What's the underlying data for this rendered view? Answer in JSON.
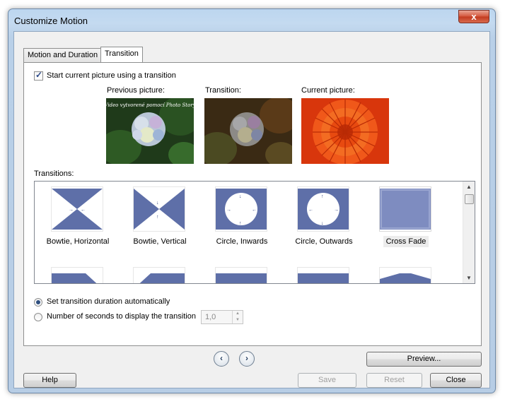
{
  "window": {
    "title": "Customize Motion",
    "close_glyph": "x"
  },
  "tabs": [
    {
      "label": "Motion and Duration",
      "active": false
    },
    {
      "label": "Transition",
      "active": true
    }
  ],
  "start_with_transition": {
    "label": "Start current picture using a transition",
    "checked": true
  },
  "pictures": [
    {
      "caption": "Previous picture:",
      "overlay_text": "Video vytvorené pomocí Photo Story"
    },
    {
      "caption": "Transition:"
    },
    {
      "caption": "Current picture:"
    }
  ],
  "transitions": {
    "label": "Transitions:",
    "items": [
      {
        "name": "Bowtie, Horizontal",
        "icon": "bowtie-horizontal-icon"
      },
      {
        "name": "Bowtie, Vertical",
        "icon": "bowtie-vertical-icon"
      },
      {
        "name": "Circle, Inwards",
        "icon": "circle-inwards-icon"
      },
      {
        "name": "Circle, Outwards",
        "icon": "circle-outwards-icon"
      },
      {
        "name": "Cross Fade",
        "icon": "cross-fade-icon",
        "selected": true
      }
    ]
  },
  "duration": {
    "auto_label": "Set transition duration automatically",
    "auto_selected": true,
    "manual_label": "Number of seconds to display the transition",
    "seconds_value": "1,0"
  },
  "buttons": {
    "preview": "Preview...",
    "help": "Help",
    "save": "Save",
    "reset": "Reset",
    "close": "Close"
  },
  "colors": {
    "accent": "#5e6fa8",
    "selected_fill": "#7e8cc0"
  }
}
